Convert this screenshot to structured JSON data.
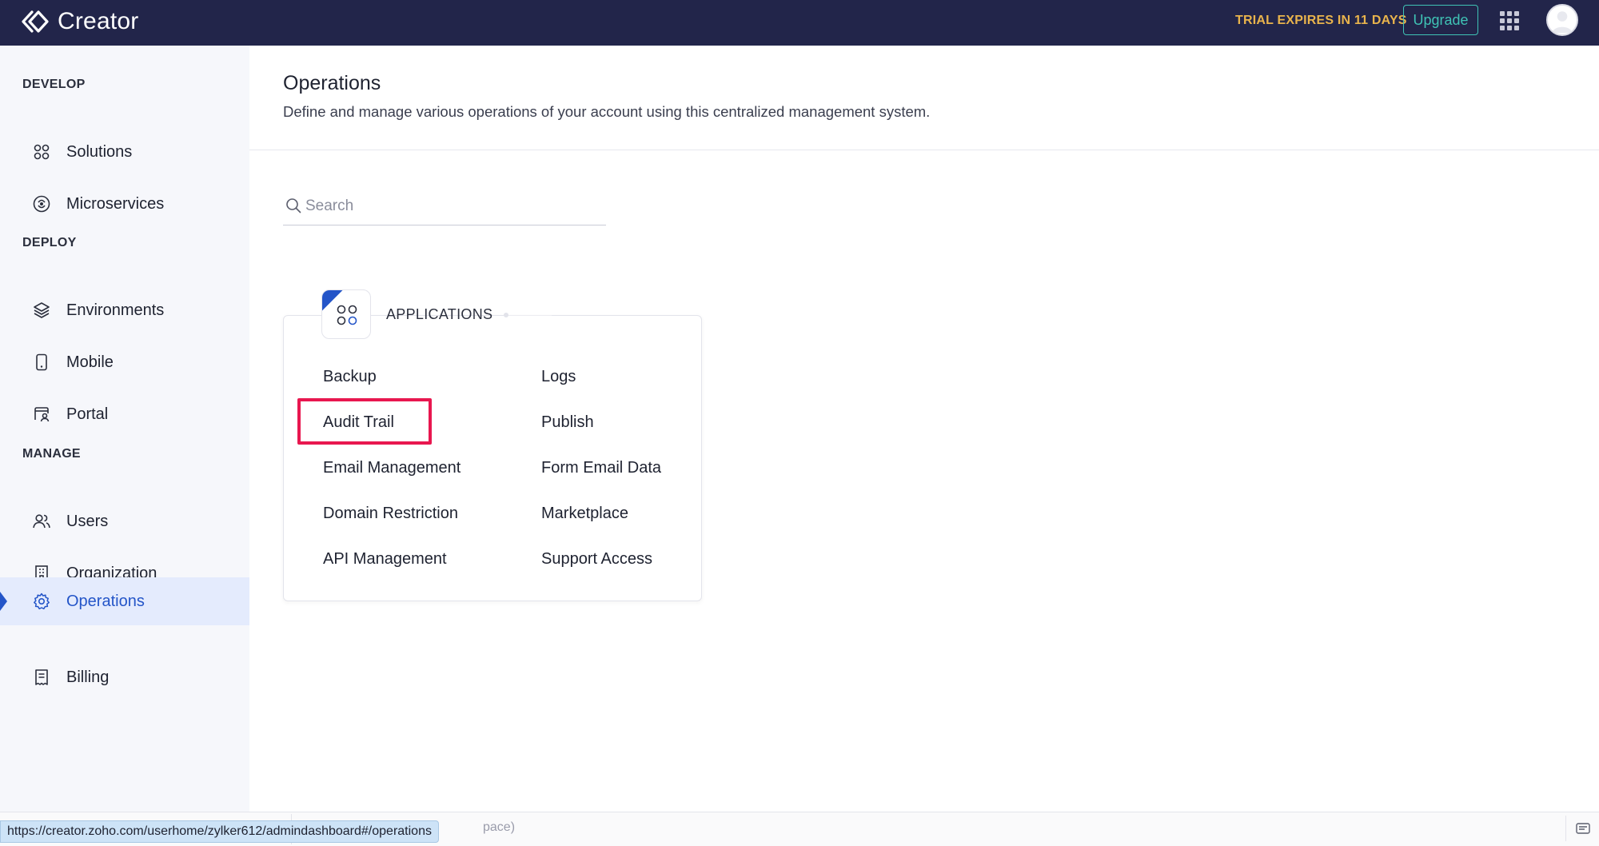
{
  "topbar": {
    "app_name": "Creator",
    "trial_text": "TRIAL EXPIRES IN 11 DAYS",
    "upgrade_label": "Upgrade"
  },
  "sidebar": {
    "sections": [
      {
        "title": "DEVELOP"
      },
      {
        "title": "DEPLOY"
      },
      {
        "title": "MANAGE"
      }
    ],
    "items": [
      {
        "label": "Solutions",
        "icon": "solutions-icon"
      },
      {
        "label": "Microservices",
        "icon": "microservices-icon"
      },
      {
        "label": "Environments",
        "icon": "layers-icon"
      },
      {
        "label": "Mobile",
        "icon": "mobile-icon"
      },
      {
        "label": "Portal",
        "icon": "portal-icon"
      },
      {
        "label": "Users",
        "icon": "users-icon"
      },
      {
        "label": "Organization",
        "icon": "building-icon"
      },
      {
        "label": "Operations",
        "icon": "gear-icon",
        "active": true
      },
      {
        "label": "Billing",
        "icon": "receipt-icon"
      }
    ]
  },
  "main": {
    "title": "Operations",
    "subtitle": "Define and manage various operations of your account using this centralized management system.",
    "search": {
      "placeholder": "Search",
      "value": ""
    },
    "card": {
      "heading": "APPLICATIONS",
      "links": [
        "Backup",
        "Logs",
        "Audit Trail",
        "Publish",
        "Email Management",
        "Form Email Data",
        "Domain Restriction",
        "Marketplace",
        "API Management",
        "Support Access"
      ],
      "highlighted": "Audit Trail"
    }
  },
  "statusbar": {
    "url": "https://creator.zoho.com/userhome/zylker612/admindashboard#/operations",
    "hint_fragment": "pace)"
  },
  "colors": {
    "topbar_bg": "#22254a",
    "accent": "#2455c8",
    "trial": "#e9b44c",
    "upgrade": "#3fc3b5",
    "highlight": "#e8174f"
  }
}
